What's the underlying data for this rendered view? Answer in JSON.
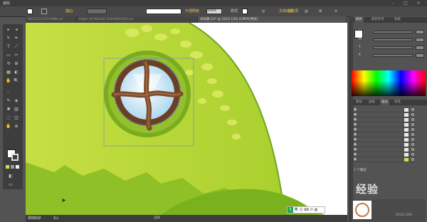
{
  "titlebar": {
    "menu_label": "编辑"
  },
  "controlbar": {
    "stroke_label": "描边:",
    "opacity_label": "不透明度",
    "opacity_value": "100%",
    "style_label": "样式",
    "doc_setup_label": "文档设置",
    "prefs_label": "首选项"
  },
  "tabs": [
    {
      "label": "481111137074880.ai*"
    },
    {
      "label": "hfgdc 24782192 20190921650.ai*"
    },
    {
      "label": "未标题-12* @ 2214.13% (CMYK/预览)"
    }
  ],
  "tools": [
    "▸",
    "◂",
    "✎",
    "✒",
    "T",
    "／",
    "▭",
    "✂",
    "⟲",
    "⊞",
    "▦",
    "◐",
    "✋",
    "🔍"
  ],
  "statusbar": {
    "zoom": "2214.13",
    "page": "1",
    "mode": "选择"
  },
  "color_panel": {
    "tabs": [
      "颜色",
      "颜色参考",
      "色板"
    ],
    "sliders": [
      {
        "key": "C",
        "value": ""
      },
      {
        "key": "M",
        "value": ""
      },
      {
        "key": "Y",
        "value": ""
      },
      {
        "key": "K",
        "value": ""
      }
    ]
  },
  "layers_panel": {
    "tabs": [
      "图层",
      "画板",
      "描边",
      "渐变"
    ],
    "rows": [
      "",
      "",
      "",
      "",
      "",
      "",
      "",
      "",
      "",
      "",
      ""
    ],
    "footer": "1 个图层"
  },
  "navigator": {
    "zoom_label": "2214.13%"
  },
  "ime": {
    "text": "英"
  },
  "watermark": {
    "text": "经验"
  },
  "colors": {
    "grass_light": "#c8e04a",
    "grass_dark": "#8cbe21",
    "wood": "#7a4a2a",
    "window_blue": "#cfe9f7",
    "panel_bg": "#535353"
  }
}
